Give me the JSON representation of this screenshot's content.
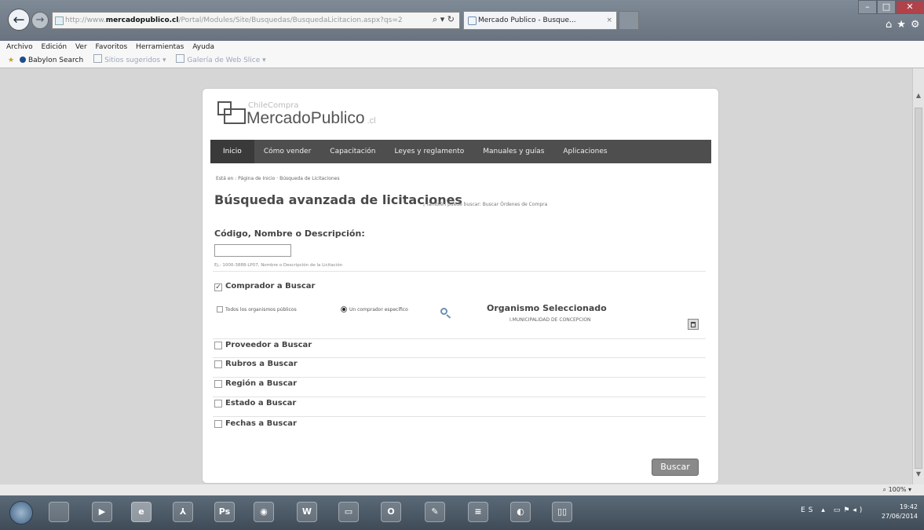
{
  "browser": {
    "url_prefix": "http://www.",
    "url_domain": "mercadopublico.cl",
    "url_rest": "/Portal/Modules/Site/Busquedas/BusquedaLicitacion.aspx?qs=2",
    "tab_title": "Mercado Publico - Busque...",
    "menu": [
      "Archivo",
      "Edición",
      "Ver",
      "Favoritos",
      "Herramientas",
      "Ayuda"
    ],
    "favorites": {
      "babylon": "Babylon Search",
      "suggested": "Sitios sugeridos ▾",
      "slice": "Galería de Web Slice ▾"
    },
    "zoom": "100%"
  },
  "site": {
    "logo_small": "ChileCompra",
    "logo_main": "MercadoPublico",
    "logo_suffix": ".cl",
    "nav": [
      "Inicio",
      "Cómo vender",
      "Capacitación",
      "Leyes y reglamento",
      "Manuales y guías",
      "Aplicaciones"
    ]
  },
  "search": {
    "breadcrumb": "Está en : Página de Inicio · Búsqueda de Licitaciones",
    "title": "Búsqueda avanzada de licitaciones",
    "title_note": "| También puede buscar: Buscar Órdenes de Compra",
    "code_heading": "Código, Nombre o Descripción:",
    "code_value": "",
    "code_hint": "Ej.: 1000-3888-LP07, Nombre o Descripción de la Licitación",
    "buyer_heading": "Comprador a Buscar",
    "option_all": "Todos los organismos públicos",
    "option_specific": "Un comprador específico",
    "org_heading": "Organismo Seleccionado",
    "org_name": "I.MUNICIPALIDAD DE CONCEPCION",
    "criteria": [
      "Proveedor a Buscar",
      "Rubros a Buscar",
      "Región a Buscar",
      "Estado a Buscar",
      "Fechas a Buscar"
    ],
    "submit_label": "Buscar"
  },
  "taskbar": {
    "icons": [
      "ie-letter",
      "pdf-letter",
      "ps-letter",
      "word-letter"
    ],
    "ie_label": "e",
    "ps_label": "Ps",
    "w_label": "W",
    "lang": "ES",
    "time": "19:42",
    "date": "27/06/2014"
  }
}
